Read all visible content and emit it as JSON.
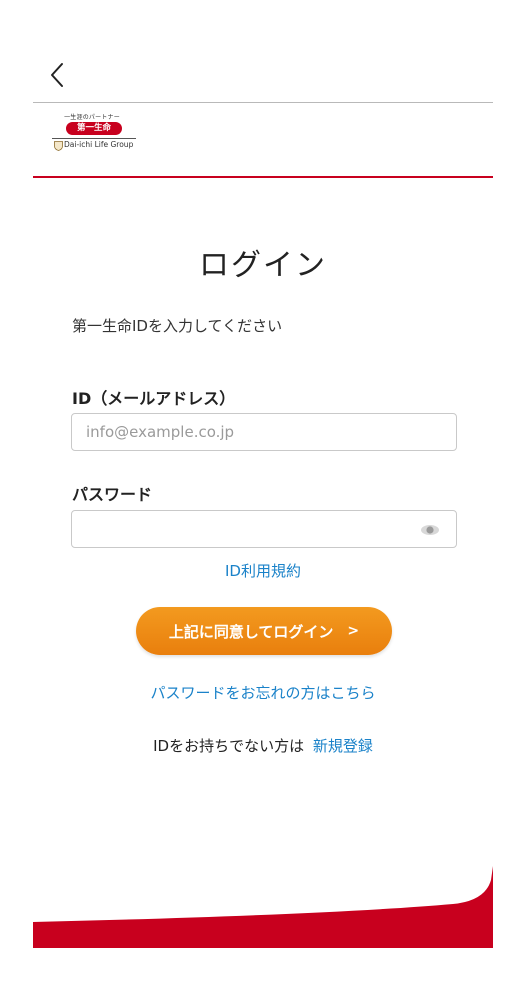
{
  "header": {
    "back_icon": "chevron-left-icon",
    "logo": {
      "tagline": "一生涯のパートナー",
      "brand": "第一生命",
      "group": "Dai-ichi Life Group"
    }
  },
  "login": {
    "title": "ログイン",
    "instruction": "第一生命IDを入力してください",
    "id_label": "ID（メールアドレス）",
    "id_placeholder": "info@example.co.jp",
    "id_value": "",
    "password_label": "パスワード",
    "password_value": "",
    "password_toggle_icon": "eye-icon",
    "terms_link": "ID利用規約",
    "submit_label": "上記に同意してログイン",
    "submit_arrow": ">",
    "forgot_link": "パスワードをお忘れの方はこちら",
    "no_id_text": "IDをお持ちでない方は",
    "signup_link": "新規登録"
  },
  "colors": {
    "brand_red": "#c8001e",
    "link_blue": "#1a82c9",
    "button_orange": "#ee8a14"
  }
}
